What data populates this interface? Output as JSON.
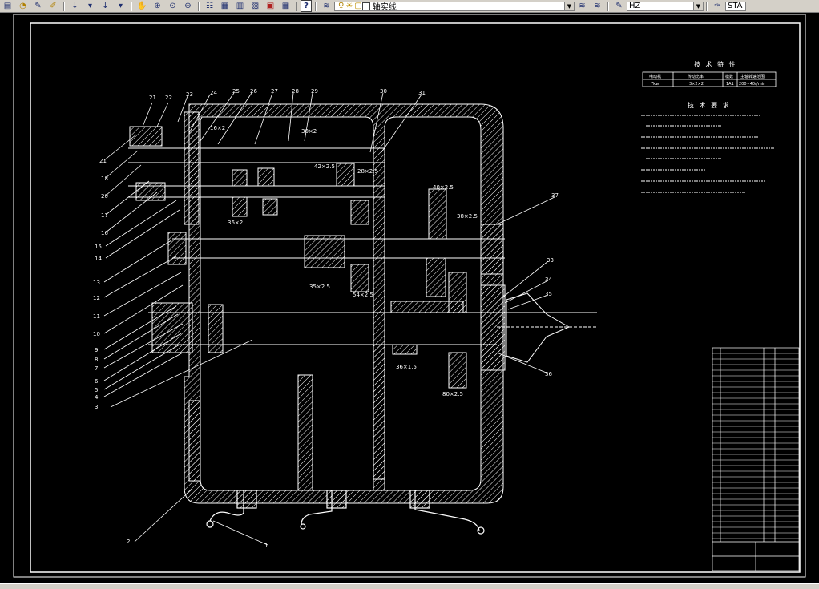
{
  "toolbar": {
    "layer_name": "轴实线",
    "linetype": "HZ",
    "style_label": "STA",
    "help_glyph": "?"
  },
  "drawing": {
    "tech_spec_title": "技 术 特 性",
    "tech_req_title": "技 术 要 求",
    "spec_table": {
      "headers": [
        "电动机",
        "传动比率",
        "模数",
        "主轴转速范围"
      ],
      "row": [
        "7kw",
        "3×2×2",
        "1A1",
        "200~40r/min"
      ]
    },
    "dims": {
      "d_16x2": "16×2",
      "d_30x2": "30×2",
      "d_42x2_5": "42×2.5",
      "d_28x2_5": "28×2.5",
      "d_40x2_5": "40×2.5",
      "d_38x2_5": "38×2.5",
      "d_36x2": "36×2",
      "d_35x2_5": "35×2.5",
      "d_54x2_5": "54×2.5",
      "d_36x1_5": "36×1.5",
      "d_80x2_5": "80×2.5"
    },
    "callouts_left": [
      "21",
      "18",
      "20",
      "17",
      "16",
      "15",
      "14",
      "13",
      "12",
      "11",
      "10",
      "9",
      "8",
      "7",
      "6",
      "5",
      "4",
      "3"
    ],
    "callouts_top": [
      "21",
      "22",
      "23",
      "24",
      "25",
      "26",
      "27",
      "28",
      "29",
      "30",
      "31"
    ],
    "callouts_right": [
      "37",
      "33",
      "34",
      "35",
      "36"
    ],
    "callouts_bottom": [
      "2",
      "1"
    ]
  }
}
